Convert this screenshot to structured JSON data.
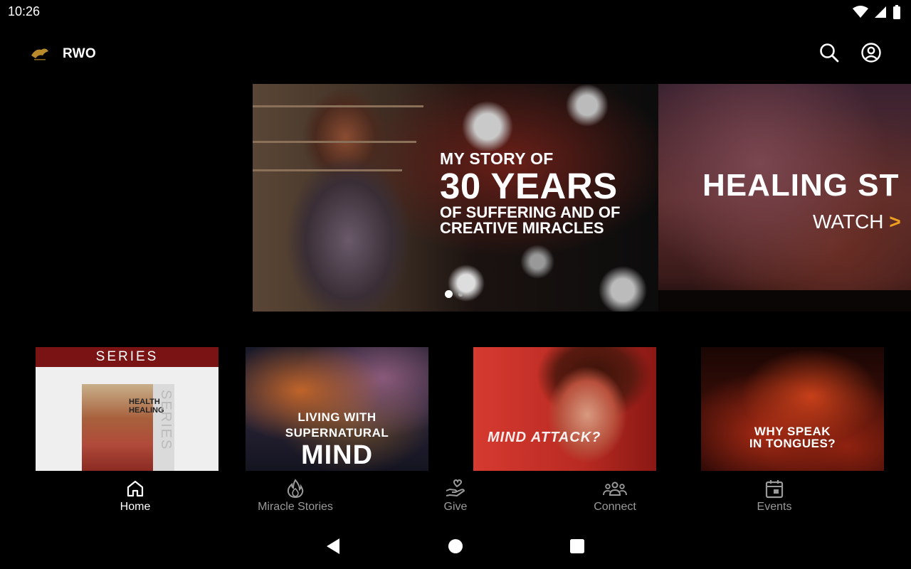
{
  "status_bar": {
    "time": "10:26",
    "icons": [
      "wifi-icon",
      "signal-icon",
      "battery-icon"
    ]
  },
  "app_bar": {
    "title": "RWO",
    "actions": [
      "search-icon",
      "account-icon"
    ]
  },
  "hero": {
    "slides": [
      {
        "line1": "MY STORY OF",
        "line2": "30 YEARS",
        "line3": "OF SUFFERING AND OF",
        "line4": "CREATIVE MIRACLES"
      },
      {
        "title": "HEALING ST",
        "watch": "WATCH",
        "watch_arrow": ">"
      }
    ],
    "active_index": 0,
    "total_slides": 2
  },
  "cards": [
    {
      "badge": "SERIES",
      "title_line1": "HEALTH",
      "title_line2": "HEALING",
      "side_text": "SERIES"
    },
    {
      "line1": "LIVING WITH",
      "line2": "SUPERNATURAL",
      "line3": "MIND"
    },
    {
      "title": "MIND ATTACK?"
    },
    {
      "line1": "WHY SPEAK",
      "line2": "IN TONGUES?"
    }
  ],
  "bottom_nav": {
    "items": [
      {
        "label": "Home",
        "icon": "home-icon",
        "active": true
      },
      {
        "label": "Miracle Stories",
        "icon": "flame-icon",
        "active": false
      },
      {
        "label": "Give",
        "icon": "give-heart-hand-icon",
        "active": false
      },
      {
        "label": "Connect",
        "icon": "people-group-icon",
        "active": false
      },
      {
        "label": "Events",
        "icon": "calendar-icon",
        "active": false
      }
    ]
  },
  "system_nav": {
    "buttons": [
      "back-icon",
      "home-circle-icon",
      "recents-icon"
    ]
  },
  "colors": {
    "background": "#000000",
    "active_nav": "#ffffff",
    "inactive_nav": "#9a9a9a",
    "series_badge": "#7a1414",
    "watch_arrow": "#f0a020"
  }
}
